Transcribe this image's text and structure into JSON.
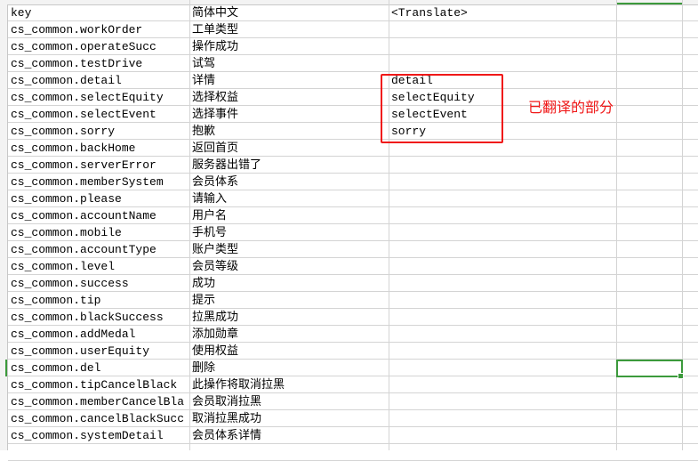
{
  "sheet": {
    "headers": [
      "key",
      "简体中文",
      "<Translate>"
    ],
    "rows": [
      [
        "cs_common.workOrder",
        "工单类型",
        ""
      ],
      [
        "cs_common.operateSucc",
        "操作成功",
        ""
      ],
      [
        "cs_common.testDrive",
        "试驾",
        ""
      ],
      [
        "cs_common.detail",
        "详情",
        "detail"
      ],
      [
        "cs_common.selectEquity",
        "选择权益",
        "selectEquity"
      ],
      [
        "cs_common.selectEvent",
        "选择事件",
        "selectEvent"
      ],
      [
        "cs_common.sorry",
        "抱歉",
        "sorry"
      ],
      [
        "cs_common.backHome",
        "返回首页",
        ""
      ],
      [
        "cs_common.serverError",
        "服务器出错了",
        ""
      ],
      [
        "cs_common.memberSystem",
        "会员体系",
        ""
      ],
      [
        "cs_common.please",
        "请输入",
        ""
      ],
      [
        "cs_common.accountName",
        "用户名",
        ""
      ],
      [
        "cs_common.mobile",
        "手机号",
        ""
      ],
      [
        "cs_common.accountType",
        "账户类型",
        ""
      ],
      [
        "cs_common.level",
        "会员等级",
        ""
      ],
      [
        "cs_common.success",
        "成功",
        ""
      ],
      [
        "cs_common.tip",
        "提示",
        ""
      ],
      [
        "cs_common.blackSuccess",
        "拉黑成功",
        ""
      ],
      [
        "cs_common.addMedal",
        "添加勋章",
        ""
      ],
      [
        "cs_common.userEquity",
        "使用权益",
        ""
      ],
      [
        "cs_common.del",
        "删除",
        ""
      ],
      [
        "cs_common.tipCancelBlack",
        "此操作将取消拉黑",
        ""
      ],
      [
        "cs_common.memberCancelBla",
        "会员取消拉黑",
        ""
      ],
      [
        "cs_common.cancelBlackSucc",
        "取消拉黑成功",
        ""
      ],
      [
        "cs_common.systemDetail",
        "会员体系详情",
        ""
      ]
    ]
  },
  "annotation": {
    "label": "已翻译的部分",
    "color": "#f01818"
  },
  "selection_color": "#3c9a3c"
}
